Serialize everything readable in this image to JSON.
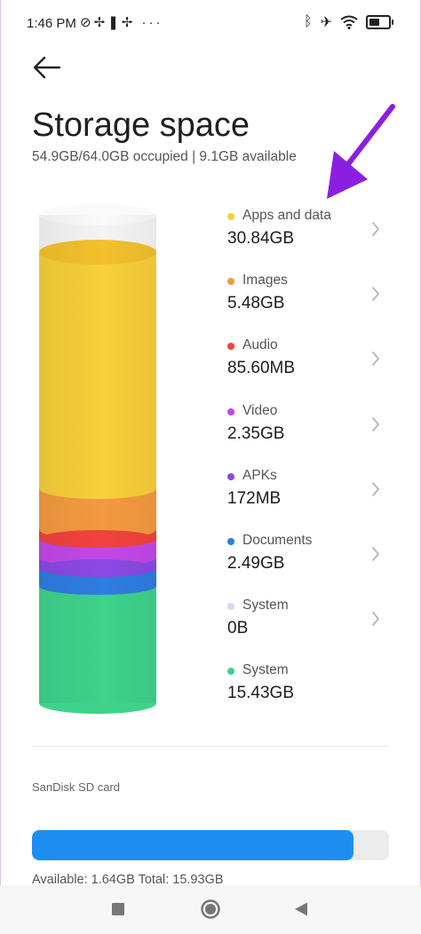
{
  "status_bar": {
    "time": "1:46 PM",
    "left_icons": [
      "do-not-disturb-icon",
      "fan-icon",
      "book-icon",
      "fan-icon",
      "more-dots-icon"
    ],
    "right_icons": [
      "bluetooth-icon",
      "airplane-icon",
      "wifi-icon",
      "battery-icon"
    ],
    "battery_level": 0.55
  },
  "header": {
    "title": "Storage space",
    "subtitle": "54.9GB/64.0GB occupied | 9.1GB available"
  },
  "categories": [
    {
      "name": "Apps and data",
      "size": "30.84GB",
      "color": "#f7cf3a"
    },
    {
      "name": "Images",
      "size": "5.48GB",
      "color": "#f39a40"
    },
    {
      "name": "Audio",
      "size": "85.60MB",
      "color": "#f2423d"
    },
    {
      "name": "Video",
      "size": "2.35GB",
      "color": "#c248e6"
    },
    {
      "name": "APKs",
      "size": "172MB",
      "color": "#8a49e3"
    },
    {
      "name": "Documents",
      "size": "2.49GB",
      "color": "#2f7de0"
    },
    {
      "name": "System",
      "size": "0B",
      "color": "#d2d6ef"
    },
    {
      "name": "System",
      "size": "15.43GB",
      "color": "#3ed28a"
    }
  ],
  "sd_card": {
    "label": "SanDisk SD card",
    "used_fraction": 0.9,
    "info": "Available: 1.64GB   Total: 15.93GB"
  },
  "colors": {
    "annotation_arrow": "#8b1fe0",
    "sd_bar": "#1e8ff0"
  }
}
